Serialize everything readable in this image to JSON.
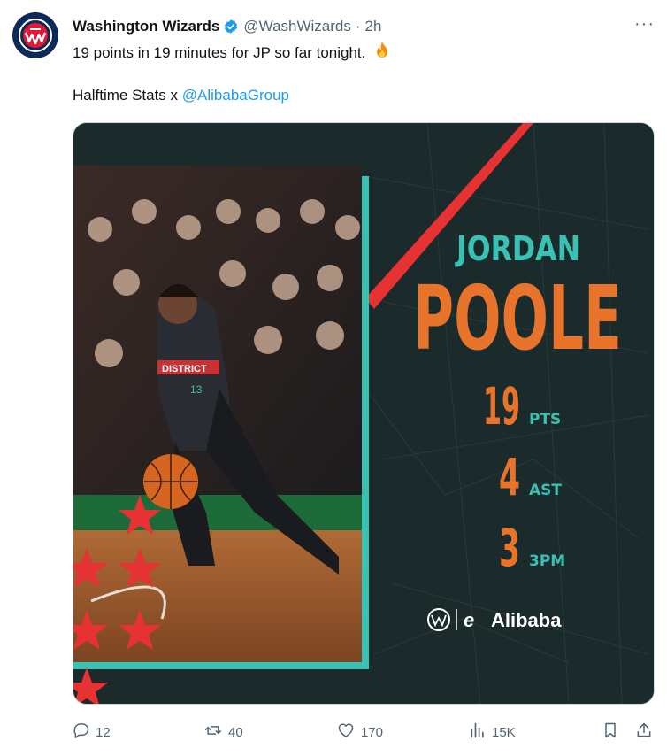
{
  "account": {
    "name": "Washington Wizards",
    "handle": "@WashWizards",
    "separator": "·",
    "time": "2h",
    "more": "···"
  },
  "tweet": {
    "text": "19 points in 19 minutes for JP so far tonight.",
    "line2_prefix": "Halftime Stats x ",
    "mention": "@AlibabaGroup"
  },
  "graphic": {
    "first_name": "JORDAN",
    "last_name": "POOLE",
    "stats": [
      {
        "value": "19",
        "label": "PTS"
      },
      {
        "value": "4",
        "label": "AST"
      },
      {
        "value": "3",
        "label": "3PM"
      }
    ],
    "sponsor": "Alibaba",
    "jersey_text": "DISTRICT",
    "jersey_number": "13",
    "colors": {
      "orange": "#e8732a",
      "teal": "#39c1b4",
      "red": "#e63232",
      "bg": "#1b2a2a"
    }
  },
  "actions": {
    "replies": "12",
    "reposts": "40",
    "likes": "170",
    "views": "15K"
  },
  "icons": [
    "verified-badge-icon",
    "fire-icon",
    "more-icon",
    "reply-icon",
    "repost-icon",
    "like-icon",
    "views-icon",
    "bookmark-icon",
    "share-icon"
  ]
}
